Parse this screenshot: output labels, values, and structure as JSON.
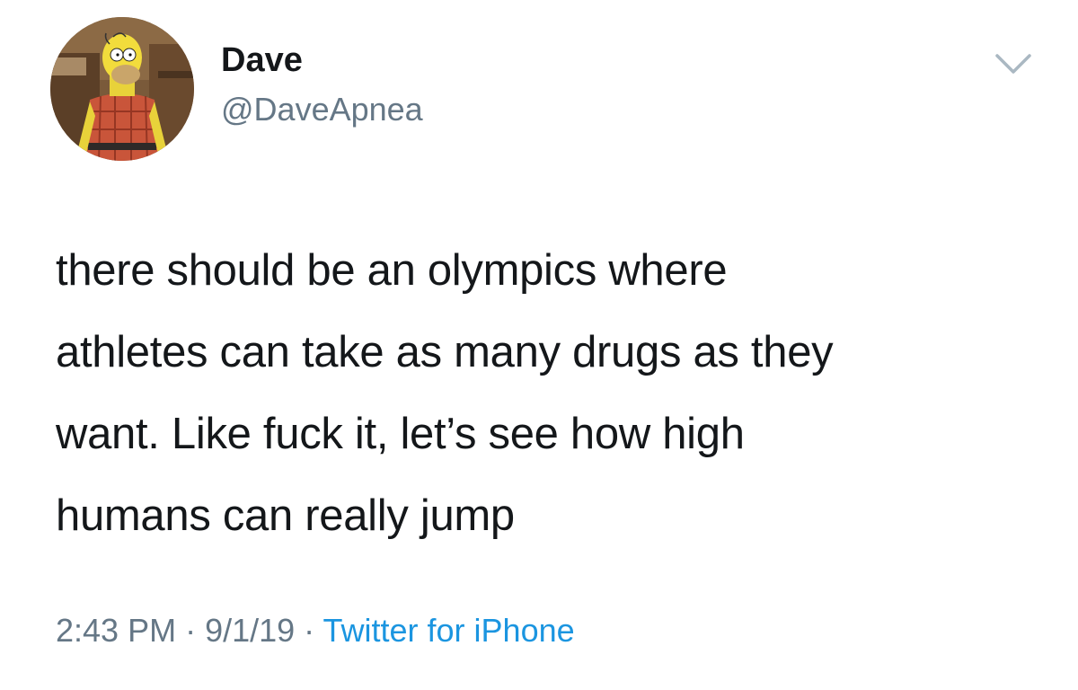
{
  "author": {
    "display_name": "Dave",
    "handle": "@DaveApnea",
    "avatar_icon": "homer-simpson-avatar"
  },
  "menu": {
    "icon": "chevron-down-icon"
  },
  "tweet": {
    "lines": [
      "there should be an olympics where",
      "athletes can take as many drugs as they",
      "want. Like fuck it, let’s see how high",
      "humans can really jump"
    ]
  },
  "meta": {
    "time": "2:43 PM",
    "separator": " · ",
    "date": "9/1/19",
    "source": "Twitter for iPhone"
  },
  "colors": {
    "text": "#14171a",
    "secondary": "#657786",
    "link": "#1b95e0",
    "background": "#ffffff"
  }
}
